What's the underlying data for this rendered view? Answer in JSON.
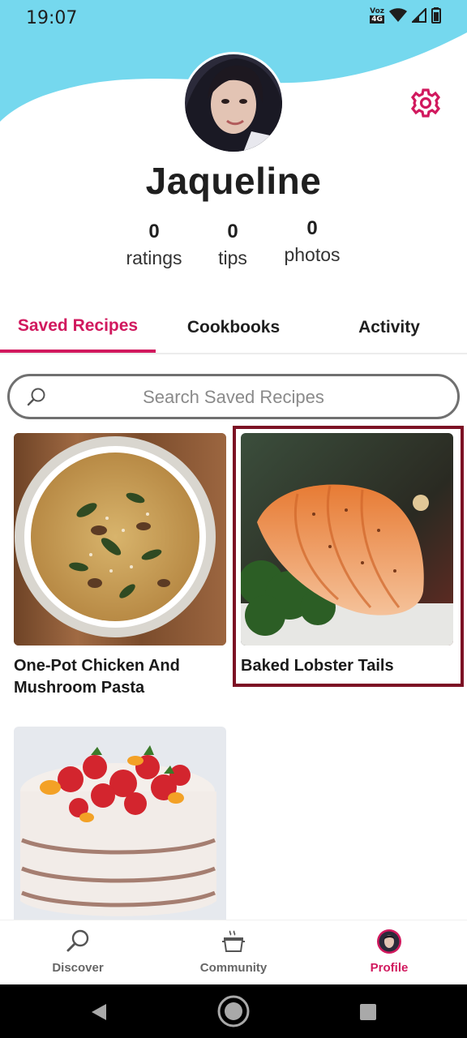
{
  "status_bar": {
    "time": "19:07",
    "network_top": "Voz",
    "network_bottom": "4G",
    "icons": [
      "wifi-icon",
      "signal-icon",
      "battery-icon"
    ]
  },
  "profile": {
    "name": "Jaqueline",
    "stats": {
      "ratings": {
        "count": "0",
        "label": "ratings"
      },
      "tips": {
        "count": "0",
        "label": "tips"
      },
      "photos": {
        "count": "0",
        "label": "photos"
      }
    }
  },
  "tabs": [
    {
      "label": "Saved Recipes",
      "active": true
    },
    {
      "label": "Cookbooks",
      "active": false
    },
    {
      "label": "Activity",
      "active": false
    }
  ],
  "search": {
    "placeholder": "Search Saved Recipes",
    "value": ""
  },
  "recipes": [
    {
      "title": "One-Pot Chicken And Mushroom Pasta"
    },
    {
      "title": "Baked Lobster Tails",
      "highlighted": true
    },
    {
      "title": ""
    }
  ],
  "bottom_nav": [
    {
      "label": "Discover",
      "icon": "search-icon",
      "active": false
    },
    {
      "label": "Community",
      "icon": "pot-icon",
      "active": false
    },
    {
      "label": "Profile",
      "icon": "avatar",
      "active": true
    }
  ],
  "colors": {
    "accent": "#d1195e",
    "header_wave": "#75d8ee",
    "highlight_border": "#7c1024"
  }
}
